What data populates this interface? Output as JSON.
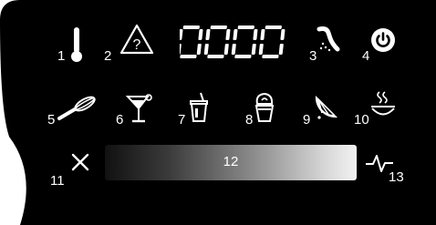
{
  "panel": {
    "background": "#000000",
    "foreground": "#ffffff",
    "display_value": "0000"
  },
  "top_row": [
    {
      "number": "1",
      "icon": "thermometer-icon"
    },
    {
      "number": "2",
      "icon": "warning-question-icon"
    },
    {
      "number": "3",
      "icon": "spray-nozzle-icon"
    },
    {
      "number": "4",
      "icon": "power-icon"
    }
  ],
  "programs": [
    {
      "number": "5",
      "icon": "whisk-icon"
    },
    {
      "number": "6",
      "icon": "cocktail-glass-icon"
    },
    {
      "number": "7",
      "icon": "smoothie-cup-icon"
    },
    {
      "number": "8",
      "icon": "ice-cream-icon"
    },
    {
      "number": "9",
      "icon": "citrus-slice-icon"
    },
    {
      "number": "10",
      "icon": "hot-soup-icon"
    }
  ],
  "bottom_row": {
    "cancel": {
      "number": "11",
      "icon": "close-icon"
    },
    "progress": {
      "number": "12",
      "icon": "gradient-bar",
      "fill_percent": 100
    },
    "pulse": {
      "number": "13",
      "icon": "pulse-icon"
    }
  }
}
